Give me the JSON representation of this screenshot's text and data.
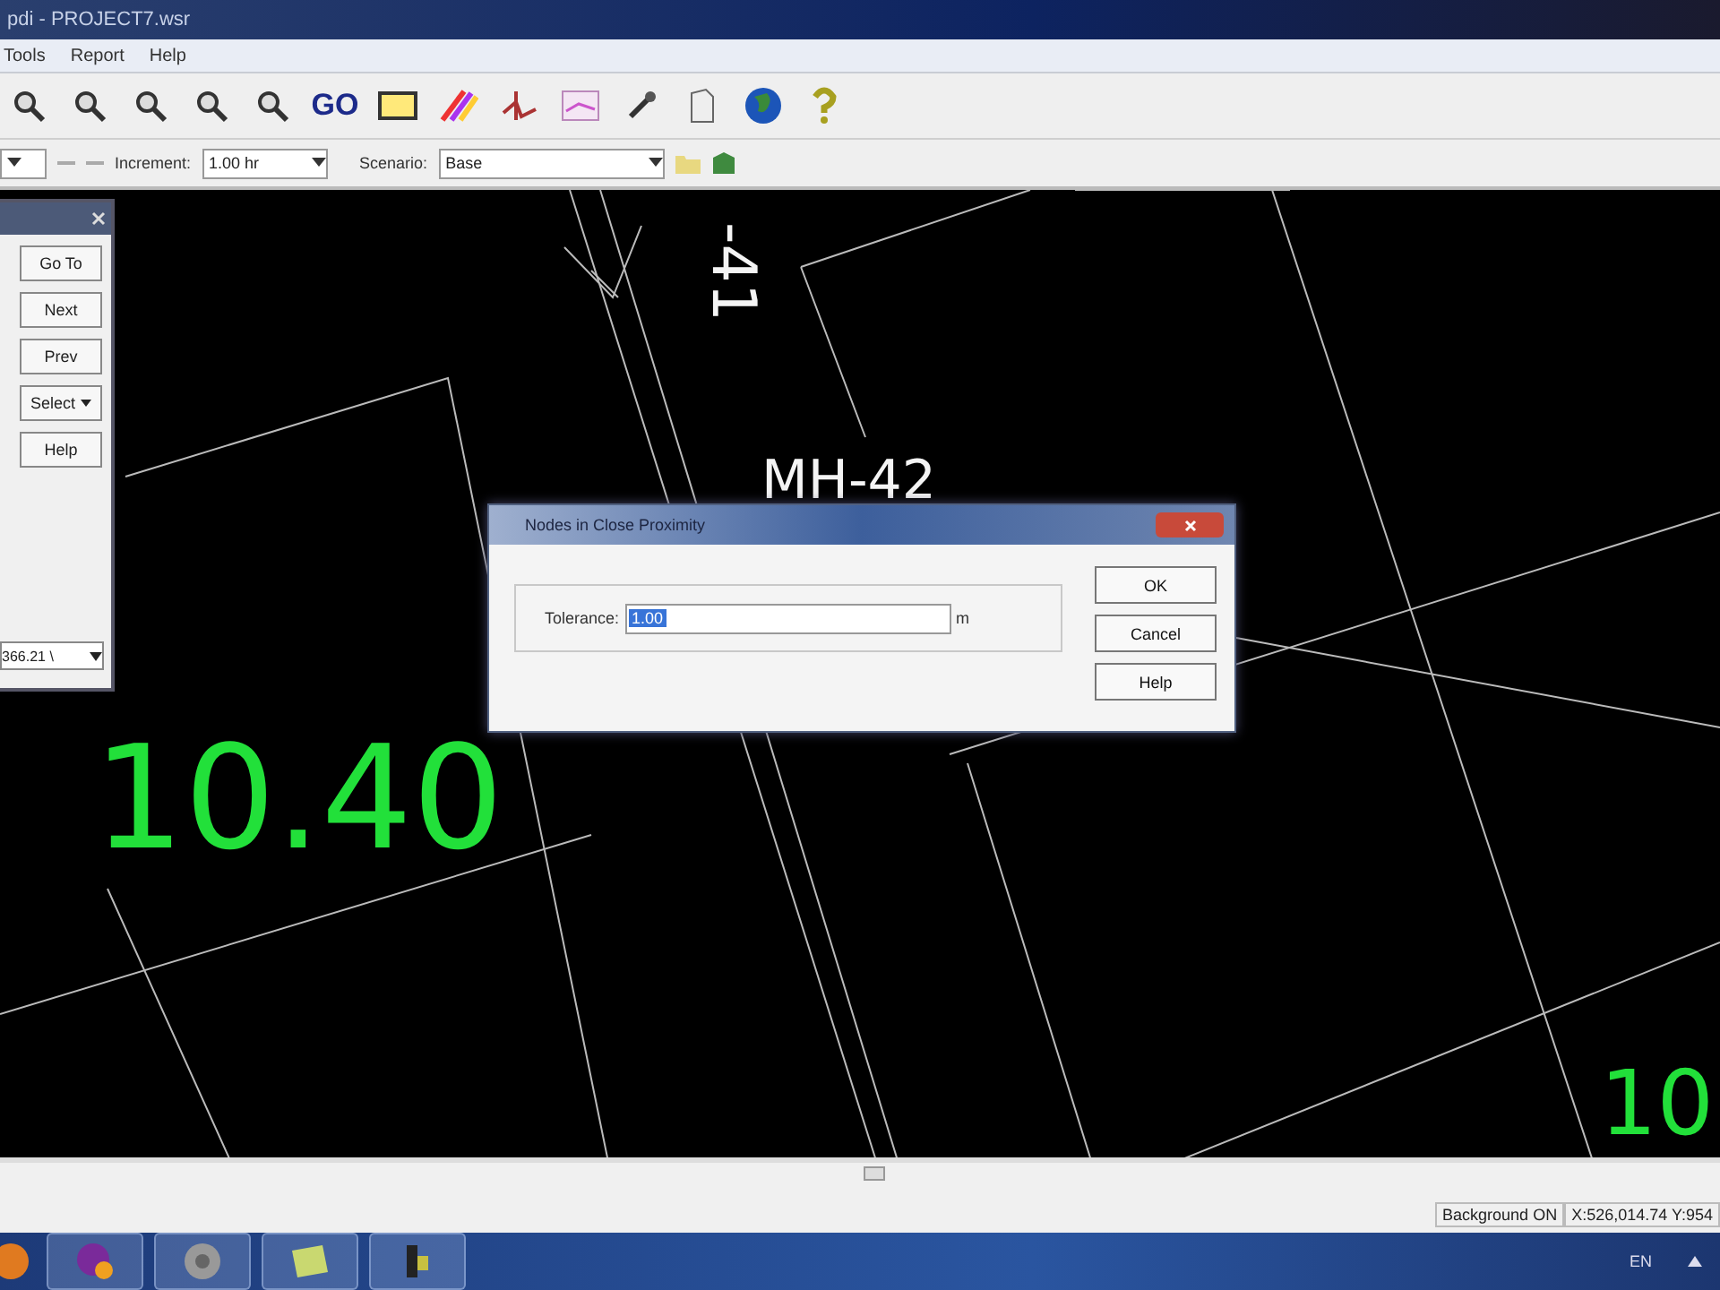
{
  "window": {
    "title": "pdi - PROJECT7.wsr"
  },
  "menu": [
    "Tools",
    "Report",
    "Help"
  ],
  "toolbar": {
    "go_label": "GO"
  },
  "options_bar": {
    "increment_label": "Increment:",
    "increment": "1.00 hr",
    "scenario_label": "Scenario:",
    "scenario": "Base"
  },
  "side_panel": {
    "buttons": [
      {
        "label": "Go To",
        "kind": "plain"
      },
      {
        "label": "Next",
        "kind": "plain"
      },
      {
        "label": "Prev",
        "kind": "plain"
      },
      {
        "label": "Select",
        "kind": "menu"
      },
      {
        "label": "Help",
        "kind": "plain"
      }
    ],
    "combo": "366.21 \\"
  },
  "canvas_labels": [
    {
      "text": "-41",
      "kind": "pipe"
    },
    {
      "text": "MH-42",
      "kind": "node"
    },
    {
      "text": "10.40",
      "kind": "value"
    },
    {
      "text": "10",
      "kind": "value"
    }
  ],
  "dialog": {
    "title": "Nodes in Close Proximity",
    "tolerance_label": "Tolerance:",
    "tolerance": "1.00",
    "tolerance_selected": true,
    "unit": "m",
    "buttons": [
      "OK",
      "Cancel",
      "Help"
    ]
  },
  "status_bar": [
    "Background ON",
    "X:526,014.74 Y:954"
  ],
  "taskbar": {
    "language": "EN"
  }
}
